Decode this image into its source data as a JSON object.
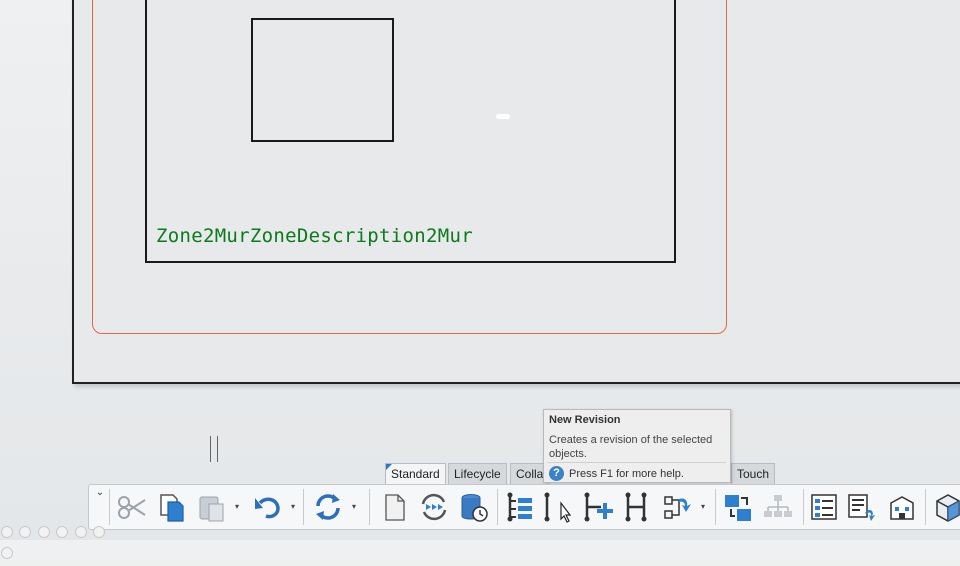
{
  "drawing": {
    "zone_label": "Zone2MurZoneDescription2Mur"
  },
  "tooltip": {
    "title": "New Revision",
    "description": "Creates a revision of the selected objects.",
    "help": "Press F1 for more help.",
    "help_icon_text": "?"
  },
  "tabs": [
    {
      "label": "Standard"
    },
    {
      "label": "Lifecycle"
    },
    {
      "label": "Colla"
    },
    {
      "label": "Touch"
    }
  ],
  "toolbar": {
    "collapse_glyph": "⌄",
    "dropdown_glyph": "▾",
    "buttons": [
      {
        "icon": "cut-icon"
      },
      {
        "icon": "copy-icon"
      },
      {
        "icon": "paste-icon"
      },
      {
        "icon": "undo-icon"
      },
      {
        "icon": "refresh-icon"
      },
      {
        "icon": "new-document-icon"
      },
      {
        "icon": "synchronize-icon"
      },
      {
        "icon": "database-history-icon"
      },
      {
        "icon": "structure-icon"
      },
      {
        "icon": "new-revision-icon"
      },
      {
        "icon": "add-structure-icon"
      },
      {
        "icon": "h-structure-icon"
      },
      {
        "icon": "h-add-icon"
      },
      {
        "icon": "branch-icon"
      },
      {
        "icon": "replace-icon"
      },
      {
        "icon": "tree-icon"
      },
      {
        "icon": "list-icon"
      },
      {
        "icon": "properties-icon"
      },
      {
        "icon": "building-icon"
      },
      {
        "icon": "cube-icon"
      }
    ]
  },
  "colors": {
    "zone_label": "#0a7a1c",
    "print_border": "#e06a4a",
    "accent": "#2a78c8"
  }
}
